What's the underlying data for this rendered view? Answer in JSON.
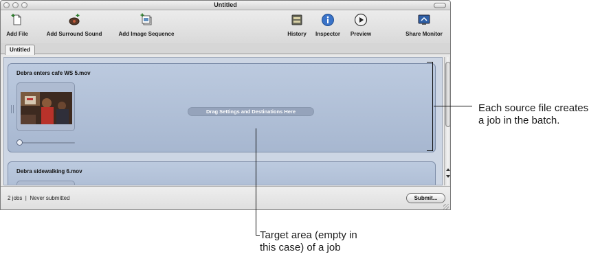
{
  "window": {
    "title": "Untitled"
  },
  "toolbar": {
    "add_file": "Add File",
    "add_surround_sound": "Add Surround Sound",
    "add_image_sequence": "Add Image Sequence",
    "history": "History",
    "inspector": "Inspector",
    "preview": "Preview",
    "share_monitor": "Share Monitor"
  },
  "tabs": [
    {
      "label": "Untitled"
    }
  ],
  "jobs": [
    {
      "filename": "Debra enters cafe WS 5.mov",
      "drop_label": "Drag Settings and Destinations Here"
    },
    {
      "filename": "Debra sidewalking 6.mov"
    }
  ],
  "status": {
    "text": "2 jobs  |  Never submitted",
    "submit_label": "Submit..."
  },
  "callouts": {
    "source_file": [
      "Each source file creates",
      "a job in the batch."
    ],
    "target_area": [
      "Target area (empty in",
      "this case) of a job"
    ]
  },
  "colors": {
    "job_fill": "#b3c2da",
    "drop_pill": "#95a3bb",
    "info_accent": "#3a73c8"
  }
}
